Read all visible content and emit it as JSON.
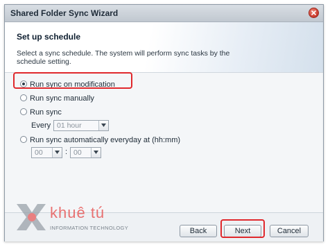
{
  "window": {
    "title": "Shared Folder Sync Wizard"
  },
  "header": {
    "heading": "Set up schedule",
    "description": "Select a sync schedule. The system will perform sync tasks by the schedule setting."
  },
  "options": {
    "on_modification": "Run sync on modification",
    "manually": "Run sync manually",
    "run_sync": "Run sync",
    "every_label": "Every",
    "every_value": "01 hour",
    "automatically": "Run sync automatically everyday at (hh:mm)",
    "hour_value": "00",
    "time_separator": ":",
    "minute_value": "00",
    "selected": "on_modification"
  },
  "footer": {
    "back_label": "Back",
    "next_label": "Next",
    "cancel_label": "Cancel"
  },
  "watermark": {
    "name": "khuê tú",
    "tagline": "INFORMATION TECHNOLOGY"
  },
  "colors": {
    "highlight": "#e0282c",
    "title_bar": "#c1c8d0"
  },
  "icons": {
    "close": "close-icon",
    "dropdown": "chevron-down-icon",
    "logo": "x-logo-icon"
  }
}
